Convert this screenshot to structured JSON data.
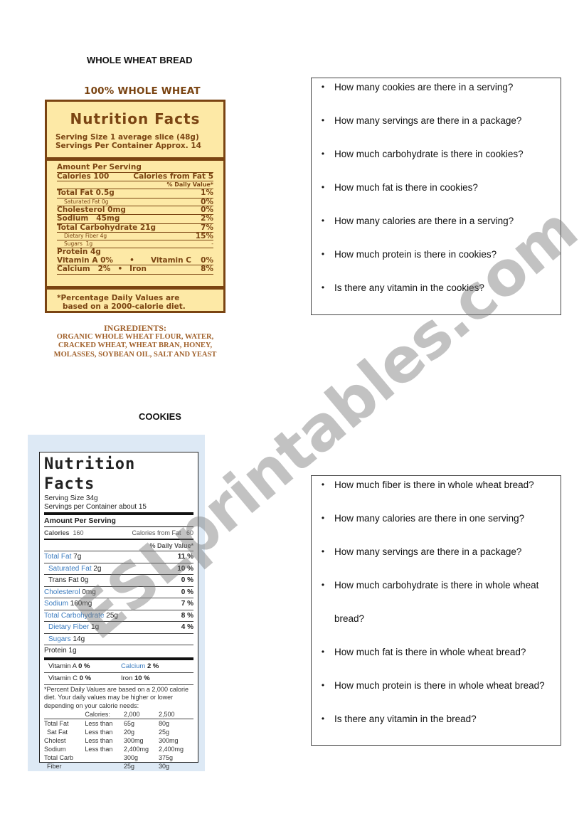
{
  "bread": {
    "section_title": "WHOLE WHEAT BREAD",
    "brand": "100% WHOLE WHEAT",
    "label_title": "Nutrition Facts",
    "serving_size": "Serving Size 1 average slice (48g)",
    "servings_per_container": "Servings Per Container Approx. 14",
    "amount_per_serving": "Amount Per Serving",
    "calories": "Calories 100",
    "calories_from_fat": "Calories from Fat  5",
    "daily_value_header": "% Daily Value*",
    "nutrients": [
      {
        "name": "Total Fat 0.5g",
        "pct": "1%"
      },
      {
        "name": "Saturated Fat 0g",
        "pct": "0%"
      },
      {
        "name": "Cholesterol 0mg",
        "pct": "0%"
      },
      {
        "name": "Sodium   45mg",
        "pct": "2%"
      },
      {
        "name": "Total Carbohydrate 21g",
        "pct": "7%"
      },
      {
        "name": "Dietary Fiber 4g",
        "pct": "15%"
      },
      {
        "name": "Sugars  1g",
        "pct": "-"
      },
      {
        "name": "Protein 4g",
        "pct": ""
      }
    ],
    "vitamins": [
      {
        "left": "Vitamin A 0%",
        "sep": "•",
        "right_name": "Vitamin C",
        "right_pct": "0%"
      },
      {
        "left": "Calcium   2%",
        "sep": "•",
        "right_name": "Iron",
        "right_pct": "8%"
      }
    ],
    "footnote_line1": "*Percentage Daily Values are",
    "footnote_line2": "based on a 2000-calorie diet.",
    "ingredients_header": "INGREDIENTS:",
    "ingredients_lines": [
      "ORGANIC WHOLE WHEAT FLOUR, WATER,",
      "CRACKED WHEAT, WHEAT BRAN, HONEY,",
      "MOLASSES, SOYBEAN OIL, SALT AND YEAST"
    ]
  },
  "cookies": {
    "section_title": "COOKIES",
    "label_title": "Nutrition Facts",
    "serving_size": "Serving Size 34g",
    "servings_per_container": "Servings per Container about 15",
    "amount_per_serving": "Amount Per Serving",
    "calories_label": "Calories",
    "calories_value": "160",
    "calories_from_fat_label": "Calories from Fat",
    "calories_from_fat_value": "60",
    "daily_value_header": "% Daily Value*",
    "nutrients": [
      {
        "name": "Total Fat",
        "amount": "7g",
        "pct": "11 %"
      },
      {
        "name": "Saturated Fat",
        "amount": "2g",
        "pct": "10 %"
      },
      {
        "name": "Trans Fat",
        "amount": "0g",
        "pct": "0 %"
      },
      {
        "name": "Cholesterol",
        "amount": "0mg",
        "pct": "0 %"
      },
      {
        "name": "Sodium",
        "amount": "160mg",
        "pct": "7 %"
      },
      {
        "name": "Total Carbohydrate",
        "amount": "25g",
        "pct": "8 %"
      },
      {
        "name": "Dietary Fiber",
        "amount": "1g",
        "pct": "4 %"
      },
      {
        "name": "Sugars",
        "amount": "14g",
        "pct": ""
      },
      {
        "name": "Protein",
        "amount": "1g",
        "pct": ""
      }
    ],
    "vitamins": [
      {
        "left_name": "Vitamin A",
        "left_pct": "0 %",
        "right_name": "Calcium",
        "right_pct": "2 %"
      },
      {
        "left_name": "Vitamin C",
        "left_pct": "0 %",
        "right_name": "Iron",
        "right_pct": "10 %"
      }
    ],
    "footnote": "*Percent Daily Values are based on a 2,000 calorie diet. Your daily values may be higher or lower depending on your calorie needs:",
    "dv_table": {
      "header": [
        "",
        "Calories:",
        "2,000",
        "2,500"
      ],
      "rows": [
        [
          "Total Fat",
          "Less than",
          "65g",
          "80g"
        ],
        [
          "Sat Fat",
          "Less than",
          "20g",
          "25g"
        ],
        [
          "Cholest",
          "Less than",
          "300mg",
          "300mg"
        ],
        [
          "Sodium",
          "Less than",
          "2,400mg",
          "2,400mg"
        ],
        [
          "Total Carb",
          "",
          "300g",
          "375g"
        ],
        [
          "Fiber",
          "",
          "25g",
          "30g"
        ]
      ]
    }
  },
  "questions_cookies": [
    "How many cookies are there in a serving?",
    "How many servings are there in a package?",
    "How much carbohydrate is there in cookies?",
    "How much fat is there in cookies?",
    "How many calories are there in a serving?",
    "How much protein is there in cookies?",
    "Is there any vitamin in the cookies?"
  ],
  "questions_bread": [
    "How much fiber is there in whole wheat bread?",
    "How many calories are there in one serving?",
    "How many servings are there in a package?",
    "How much carbohydrate is there in whole wheat",
    "bread?",
    "How much fat is there in whole wheat bread?",
    "How much protein is there in whole wheat bread?",
    "Is there any vitamin in the bread?"
  ],
  "bullet_glyph": "•",
  "watermark": "ESLprintables.com",
  "colors": {
    "bread_label_bg": "#fde9a6",
    "bread_label_brown": "#7a4412",
    "ingredients_brown": "#a0602a",
    "cookie_bg": "#dde9f5",
    "cookie_nutrient_blue": "#3a7bbf"
  }
}
